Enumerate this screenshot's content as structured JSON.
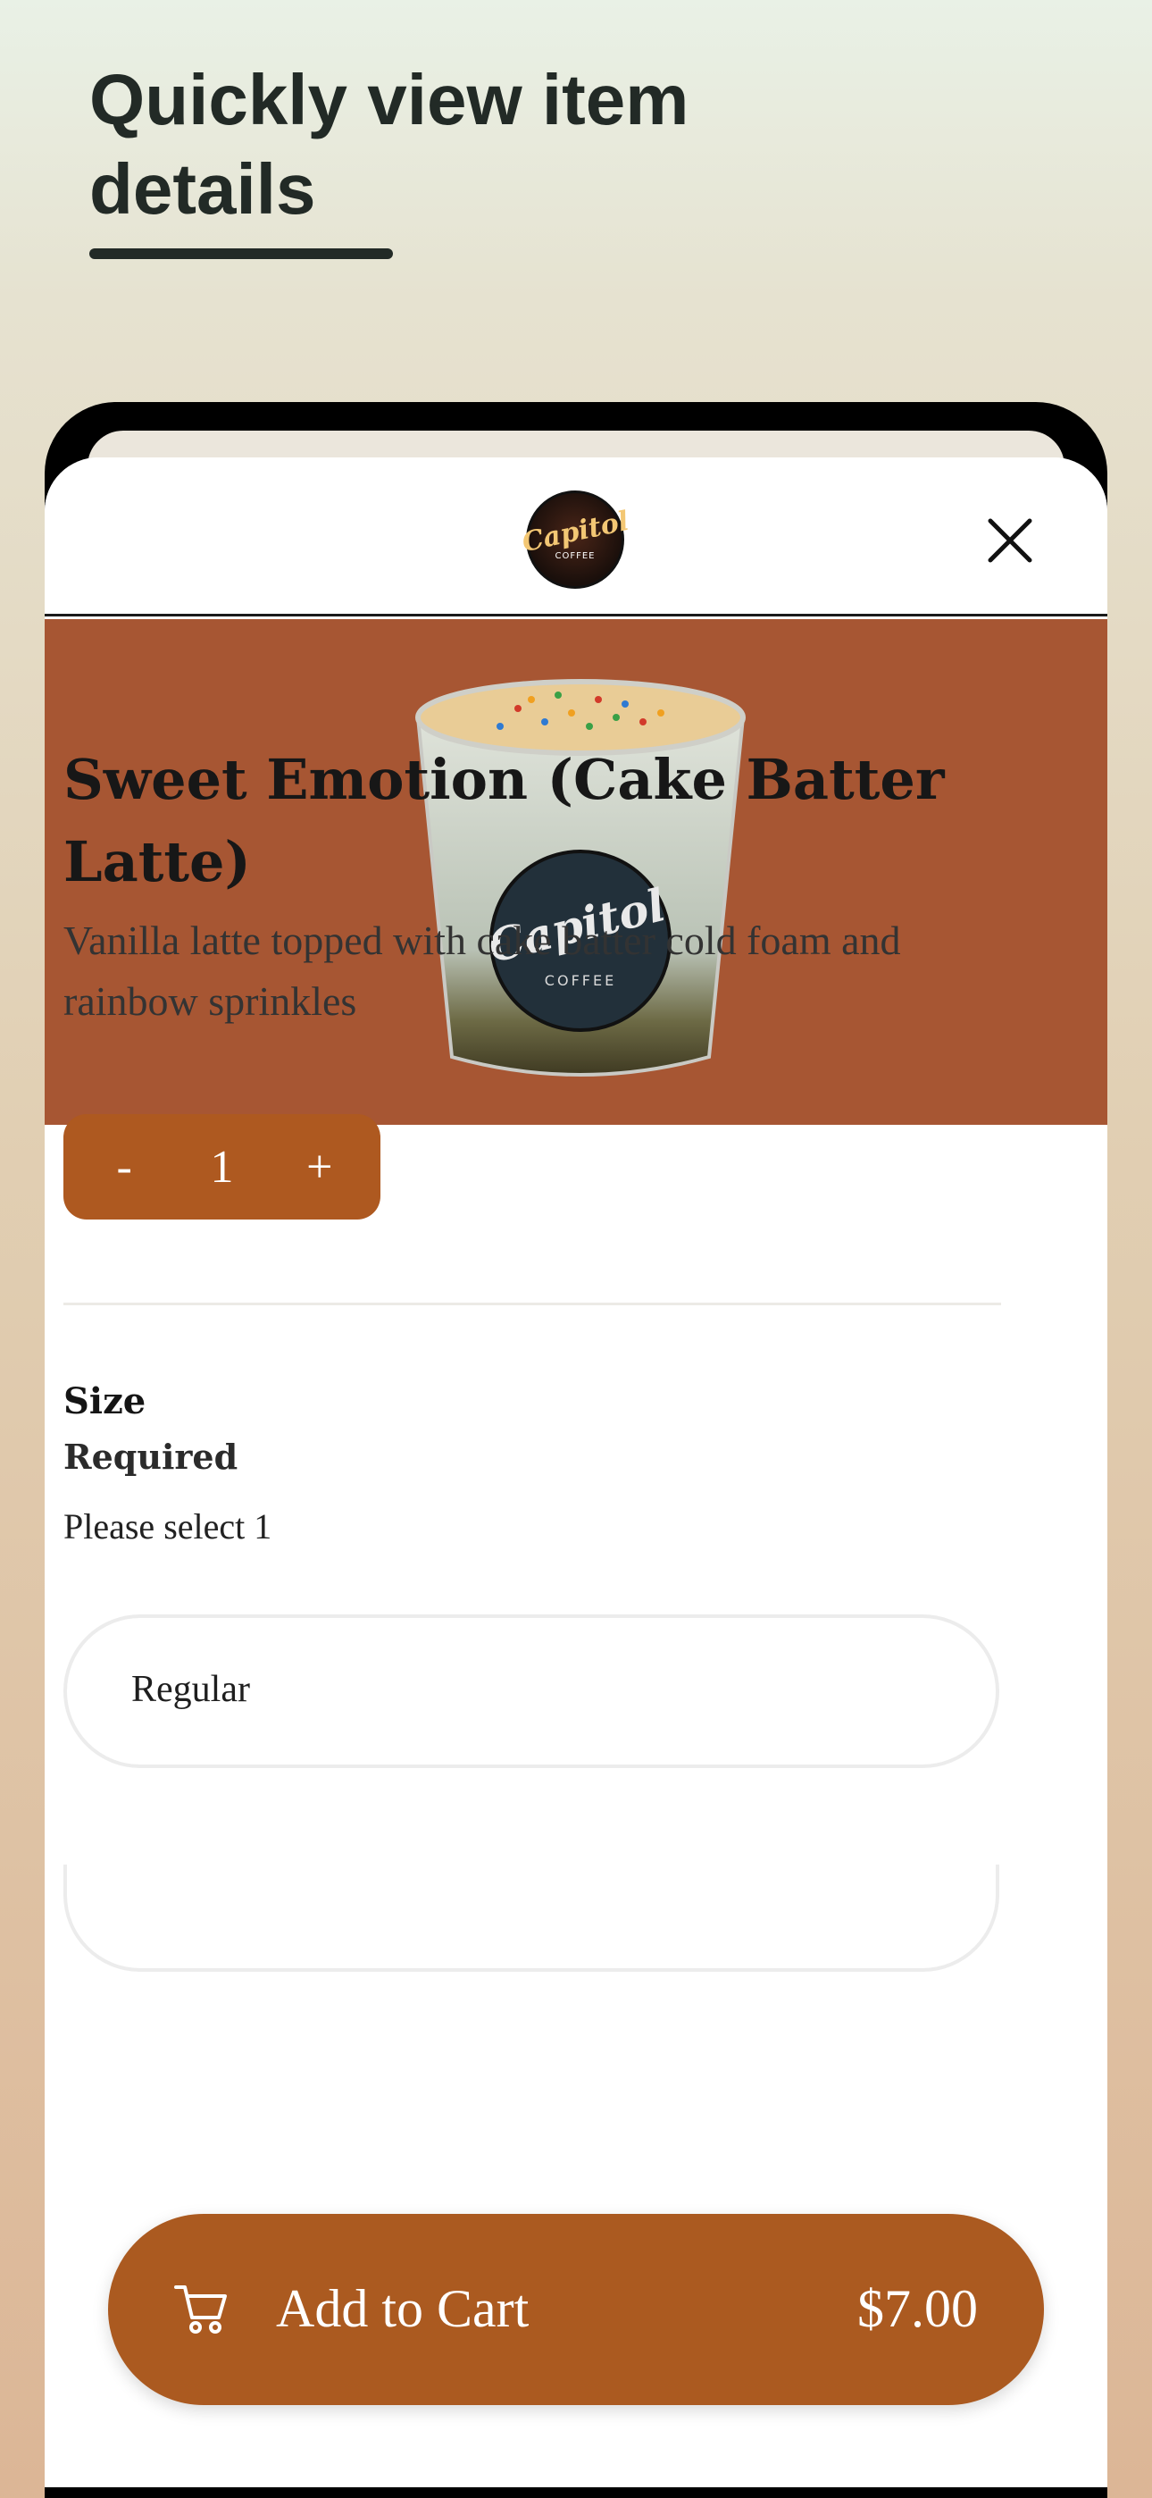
{
  "promo": {
    "headline": "Quickly view item details"
  },
  "modal": {
    "logo": {
      "script_text": "Capitol",
      "sub_text": "COFFEE"
    },
    "close_icon": "close-icon",
    "product": {
      "name": "Sweet Emotion (Cake Batter Latte)",
      "description": "Vanilla latte topped with cake batter cold foam and rainbow sprinkles",
      "hero_background": "#a75633"
    },
    "quantity": {
      "decrement_label": "-",
      "value": "1",
      "increment_label": "+"
    },
    "options_group": {
      "title": "Size",
      "required_label": "Required",
      "instruction": "Please select 1",
      "options": [
        {
          "label": "Regular"
        }
      ]
    },
    "add_to_cart": {
      "label": "Add to Cart",
      "price": "$7.00",
      "icon": "cart-icon",
      "color": "#ab5a20"
    }
  }
}
